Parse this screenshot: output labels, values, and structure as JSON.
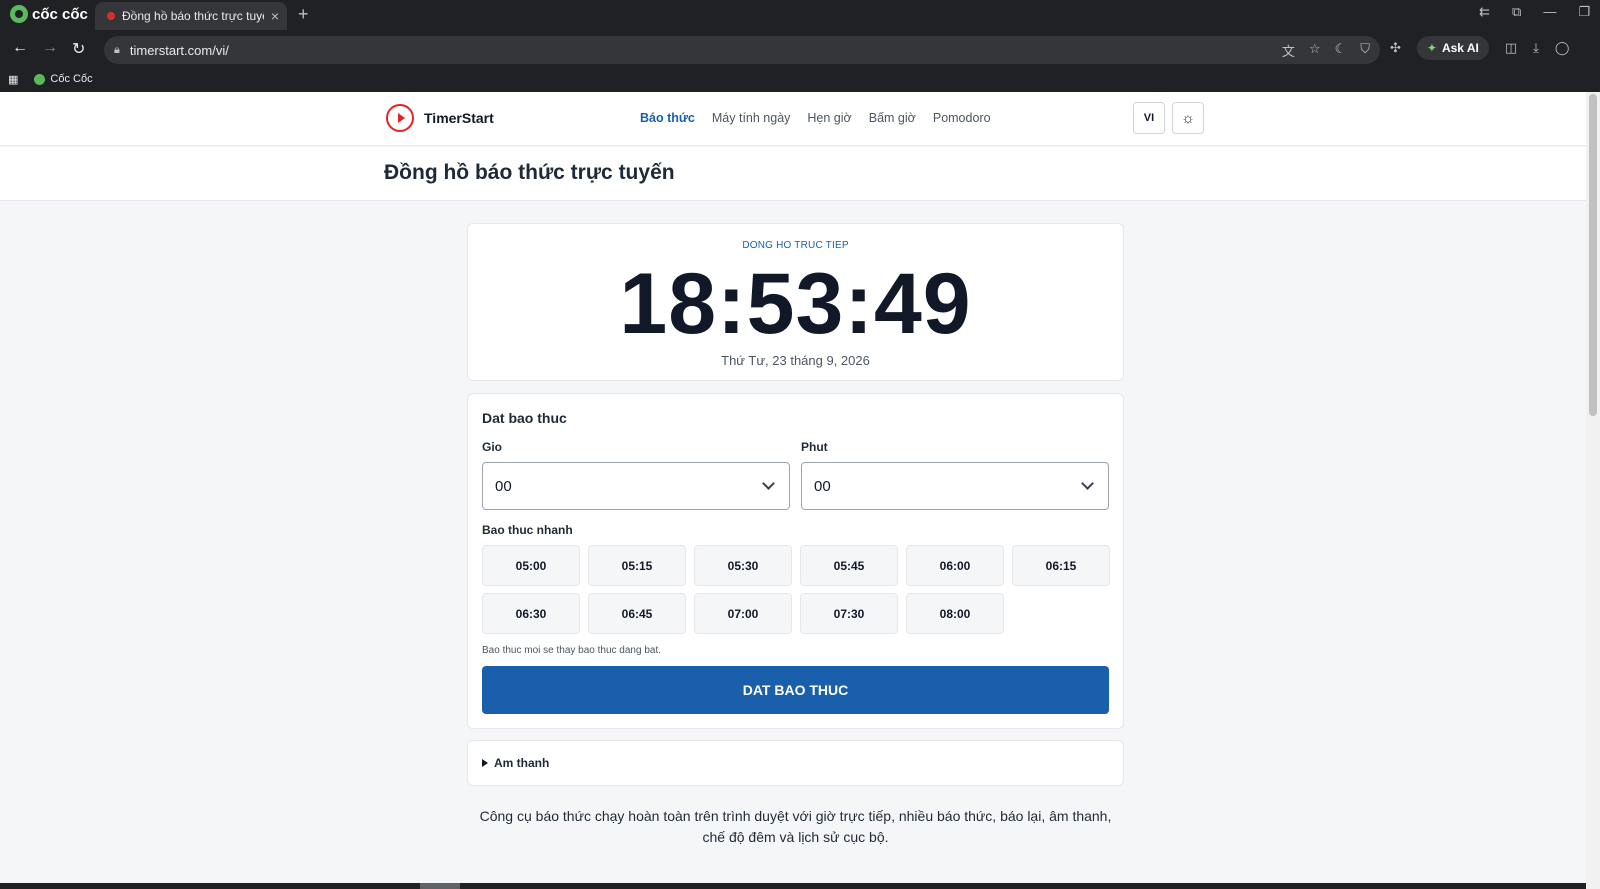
{
  "browser": {
    "brand": "cốc cốc",
    "tab_title": "Đồng hồ báo thức trực tuyến",
    "tab_close": "×",
    "new_tab": "+",
    "url": "timerstart.com/vi/",
    "ask_ai": "Ask AI",
    "bookmark": "Cốc Cốc",
    "icons": [
      "back-icon",
      "forward-icon",
      "reload-icon",
      "lock-icon",
      "translate-icon",
      "star-icon",
      "moon-icon",
      "shield-icon",
      "extensions-icon",
      "split-view-icon",
      "download-icon",
      "profile-icon",
      "apps-grid-icon"
    ]
  },
  "site": {
    "name": "TimerStart",
    "nav": [
      {
        "label": "Báo thức",
        "active": true
      },
      {
        "label": "Máy tính ngày",
        "active": false
      },
      {
        "label": "Hẹn giờ",
        "active": false
      },
      {
        "label": "Bấm giờ",
        "active": false
      },
      {
        "label": "Pomodoro",
        "active": false
      }
    ],
    "lang_button": "VI",
    "theme_icon": "sun-icon"
  },
  "page": {
    "title": "Đồng hồ báo thức trực tuyến",
    "clock": {
      "label": "DONG HO TRUC TIEP",
      "time": "18:53:49",
      "date": "Thứ Tư, 23 tháng 9, 2026"
    },
    "alarm": {
      "title": "Dat bao thuc",
      "hour_label": "Gio",
      "minute_label": "Phut",
      "hour_value": "00",
      "minute_value": "00",
      "quick_label": "Bao thuc nhanh",
      "quick_times": [
        "05:00",
        "05:15",
        "05:30",
        "05:45",
        "06:00",
        "06:15",
        "06:30",
        "06:45",
        "07:00",
        "07:30",
        "08:00"
      ],
      "hint": "Bao thuc moi se thay bao thuc dang bat.",
      "submit": "DAT BAO THUC"
    },
    "sound": {
      "label": "Am thanh"
    },
    "description": "Công cụ báo thức chạy hoàn toàn trên trình duyệt với giờ trực tiếp, nhiều báo thức, báo lại, âm thanh, chế độ đêm và lịch sử cục bộ."
  },
  "colors": {
    "accent": "#1a5fab",
    "page_bg": "#f5f6f8",
    "chrome_bg": "#202124"
  }
}
